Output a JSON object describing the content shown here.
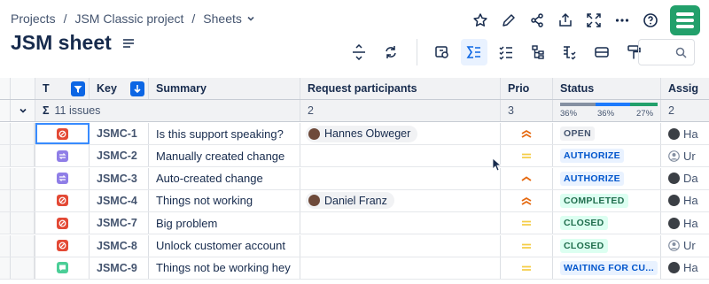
{
  "breadcrumbs": [
    "Projects",
    "JSM Classic project",
    "Sheets"
  ],
  "page_title": "JSM sheet",
  "search": {
    "placeholder": ""
  },
  "columns": {
    "type": "T",
    "key": "Key",
    "summary": "Summary",
    "participants": "Request participants",
    "prio": "Prio",
    "status": "Status",
    "assignee": "Assig"
  },
  "group": {
    "label": "11 issues",
    "participants_count": "2",
    "prio_count": "3",
    "status_pcts": [
      "36%",
      "36%",
      "27%"
    ],
    "assignee_count": "2"
  },
  "rows": [
    {
      "type": "incident",
      "key": "JSMC-1",
      "summary": "Is this support speaking?",
      "participant": "Hannes Obweger",
      "prio": "highest",
      "status": "OPEN",
      "status_style": "grey",
      "assignee": "Ha"
    },
    {
      "type": "change",
      "key": "JSMC-2",
      "summary": "Manually created change",
      "participant": "",
      "prio": "medium",
      "status": "AUTHORIZE",
      "status_style": "blue",
      "assignee": "Ur"
    },
    {
      "type": "change",
      "key": "JSMC-3",
      "summary": "Auto-created change",
      "participant": "",
      "prio": "high",
      "status": "AUTHORIZE",
      "status_style": "blue",
      "assignee": "Da"
    },
    {
      "type": "incident",
      "key": "JSMC-4",
      "summary": "Things not working",
      "participant": "Daniel Franz",
      "prio": "highest",
      "status": "COMPLETED",
      "status_style": "green",
      "assignee": "Ha"
    },
    {
      "type": "incident",
      "key": "JSMC-7",
      "summary": "Big problem",
      "participant": "",
      "prio": "medium",
      "status": "CLOSED",
      "status_style": "green",
      "assignee": "Ha"
    },
    {
      "type": "incident",
      "key": "JSMC-8",
      "summary": "Unlock customer account",
      "participant": "",
      "prio": "medium",
      "status": "CLOSED",
      "status_style": "green",
      "assignee": "Ur"
    },
    {
      "type": "request",
      "key": "JSMC-9",
      "summary": "Things not be working hey",
      "participant": "",
      "prio": "medium",
      "status": "WAITING FOR CU...",
      "status_style": "blue",
      "assignee": "Ha"
    }
  ],
  "colors": {
    "accent": "#0c66e4",
    "incident": "#e34935",
    "change": "#8f7ee7",
    "request": "#4bce97",
    "prio_high": "#e56910",
    "prio_medium": "#f5cd47",
    "logo": "#22a06b"
  },
  "icons": [
    "star-icon",
    "edit-icon",
    "share-icon",
    "export-icon",
    "fullscreen-icon",
    "more-icon",
    "help-icon"
  ]
}
